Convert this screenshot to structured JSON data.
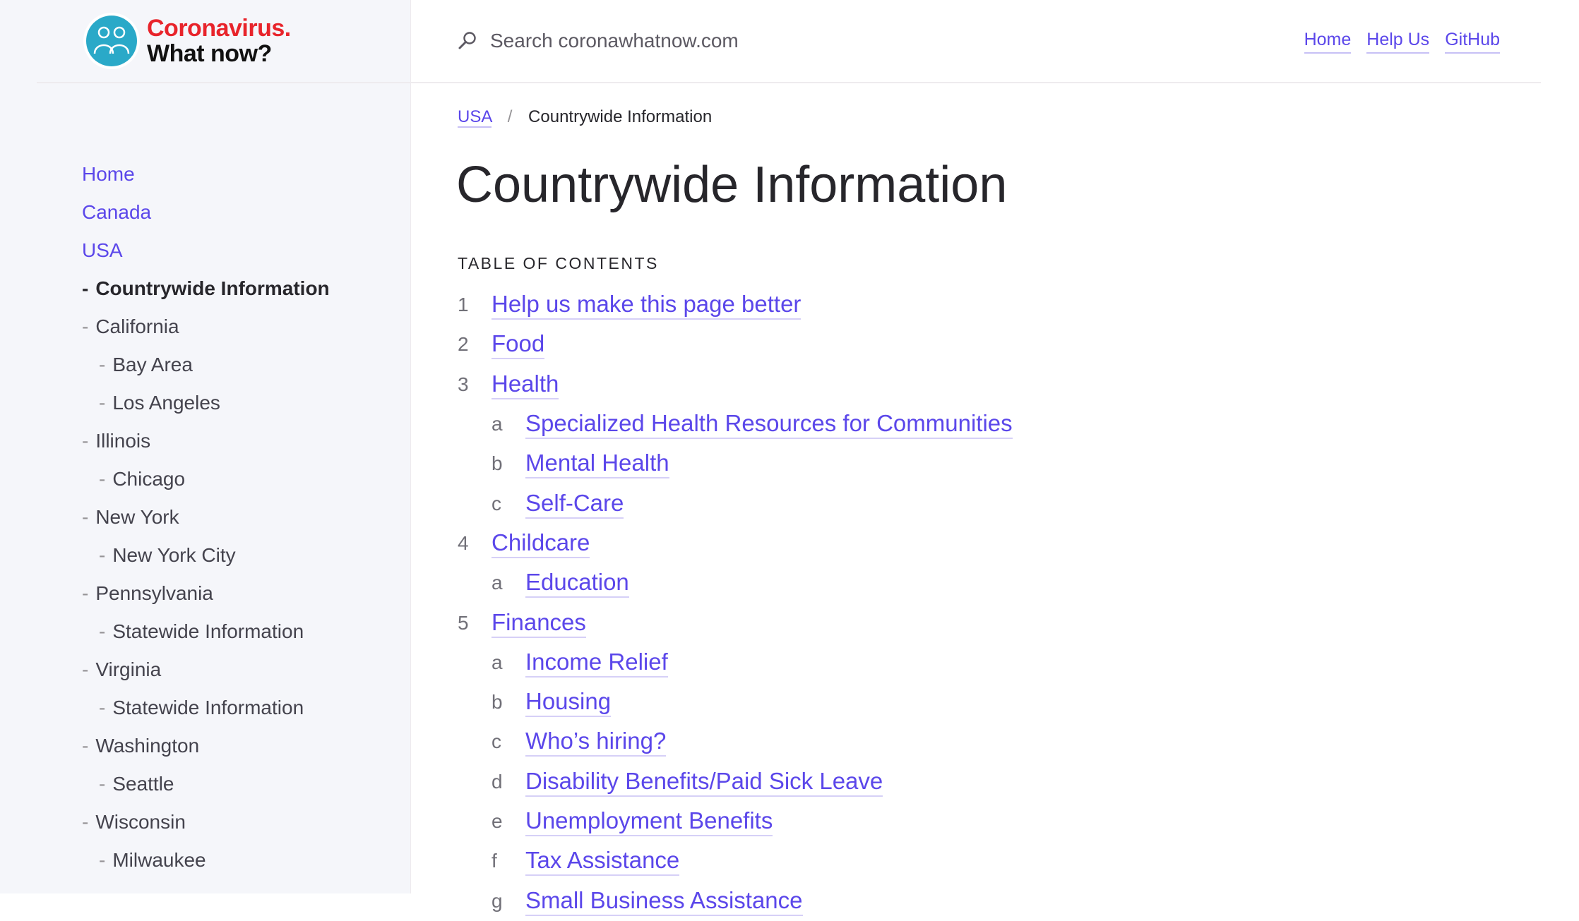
{
  "logo": {
    "line1": "Coronavirus.",
    "line2": "What now?",
    "icon": "people-icon"
  },
  "search": {
    "placeholder": "Search coronawhatnow.com",
    "icon": "search-icon"
  },
  "top_nav": [
    "Home",
    "Help Us",
    "GitHub"
  ],
  "sidebar": {
    "items": [
      {
        "label": "Home",
        "level": 0
      },
      {
        "label": "Canada",
        "level": 0
      },
      {
        "label": "USA",
        "level": 0
      },
      {
        "label": "Countrywide Information",
        "level": 1,
        "active": true
      },
      {
        "label": "California",
        "level": 1
      },
      {
        "label": "Bay Area",
        "level": 2
      },
      {
        "label": "Los Angeles",
        "level": 2
      },
      {
        "label": "Illinois",
        "level": 1
      },
      {
        "label": "Chicago",
        "level": 2
      },
      {
        "label": "New York",
        "level": 1
      },
      {
        "label": "New York City",
        "level": 2
      },
      {
        "label": "Pennsylvania",
        "level": 1
      },
      {
        "label": "Statewide Information",
        "level": 2
      },
      {
        "label": "Virginia",
        "level": 1
      },
      {
        "label": "Statewide Information",
        "level": 2
      },
      {
        "label": "Washington",
        "level": 1
      },
      {
        "label": "Seattle",
        "level": 2
      },
      {
        "label": "Wisconsin",
        "level": 1
      },
      {
        "label": "Milwaukee",
        "level": 2
      }
    ],
    "dash": "-"
  },
  "breadcrumb": {
    "parent": "USA",
    "separator": "/",
    "current": "Countrywide Information"
  },
  "page_title": "Countrywide Information",
  "toc": {
    "heading": "TABLE OF CONTENTS",
    "items": [
      {
        "marker": "1",
        "label": "Help us make this page better",
        "level": 0
      },
      {
        "marker": "2",
        "label": "Food",
        "level": 0
      },
      {
        "marker": "3",
        "label": "Health",
        "level": 0
      },
      {
        "marker": "a",
        "label": "Specialized Health Resources for Communities",
        "level": 1
      },
      {
        "marker": "b",
        "label": "Mental Health",
        "level": 1
      },
      {
        "marker": "c",
        "label": "Self-Care",
        "level": 1
      },
      {
        "marker": "4",
        "label": "Childcare",
        "level": 0
      },
      {
        "marker": "a",
        "label": "Education",
        "level": 1
      },
      {
        "marker": "5",
        "label": "Finances",
        "level": 0
      },
      {
        "marker": "a",
        "label": "Income Relief",
        "level": 1
      },
      {
        "marker": "b",
        "label": "Housing",
        "level": 1
      },
      {
        "marker": "c",
        "label": "Who’s hiring?",
        "level": 1
      },
      {
        "marker": "d",
        "label": "Disability Benefits/Paid Sick Leave",
        "level": 1
      },
      {
        "marker": "e",
        "label": "Unemployment Benefits",
        "level": 1
      },
      {
        "marker": "f",
        "label": "Tax Assistance",
        "level": 1
      },
      {
        "marker": "g",
        "label": "Small Business Assistance",
        "level": 1
      }
    ]
  },
  "colors": {
    "link": "#5b47ea",
    "sidebar_bg": "#f5f6fa",
    "logo_red": "#e8242b",
    "logo_circle": "#2aa9c8"
  }
}
